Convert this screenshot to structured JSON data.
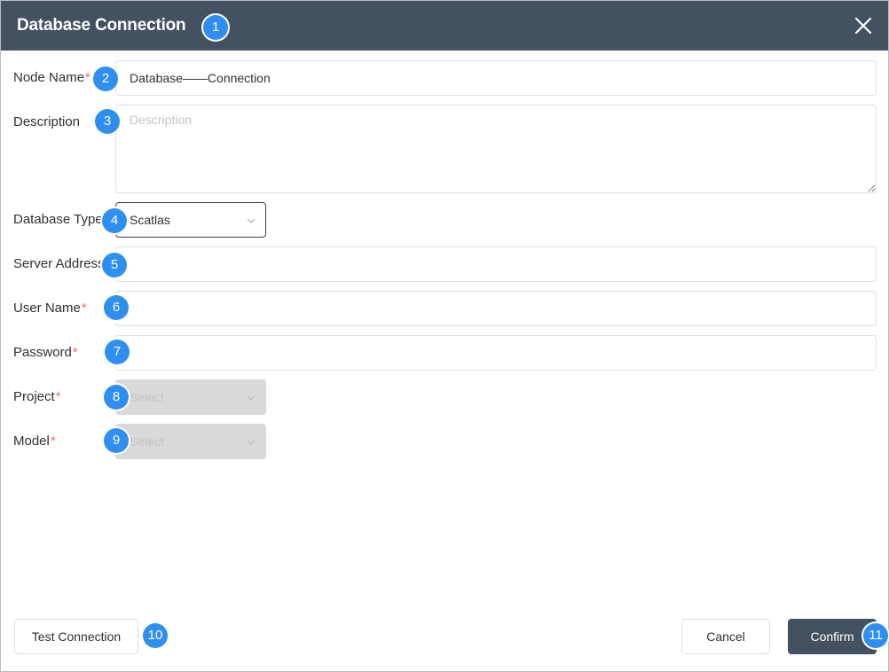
{
  "dialog": {
    "title": "Database Connection",
    "close_icon": "close-icon"
  },
  "form": {
    "node_name": {
      "label": "Node Name",
      "required_mark": "*",
      "value": "Database——Connection"
    },
    "description": {
      "label": "Description",
      "placeholder": "Description",
      "value": ""
    },
    "database_type": {
      "label": "Database Type",
      "value": "Scatlas"
    },
    "server_address": {
      "label": "Server Address",
      "value": ""
    },
    "user_name": {
      "label": "User Name",
      "required_mark": "*",
      "value": ""
    },
    "password": {
      "label": "Password",
      "required_mark": "*",
      "value": ""
    },
    "project": {
      "label": "Project",
      "required_mark": "*",
      "placeholder": "Select"
    },
    "model": {
      "label": "Model",
      "required_mark": "*",
      "placeholder": "Select"
    }
  },
  "footer": {
    "test_connection_label": "Test Connection",
    "cancel_label": "Cancel",
    "confirm_label": "Confirm"
  },
  "annotations": [
    "1",
    "2",
    "3",
    "4",
    "5",
    "6",
    "7",
    "8",
    "9",
    "10",
    "11"
  ],
  "colors": {
    "header_bg": "#435160",
    "badge": "#2e8ff0",
    "required": "#f56c6c",
    "primary_button": "#435160"
  }
}
